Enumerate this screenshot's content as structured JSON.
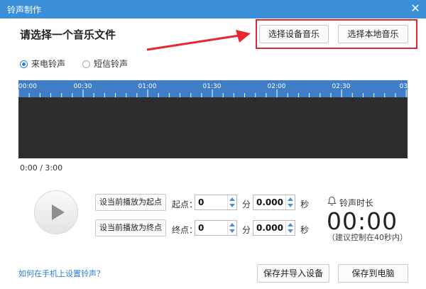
{
  "window": {
    "title": "铃声制作",
    "close_glyph": "✕"
  },
  "header": {
    "heading": "请选择一个音乐文件",
    "device_button": "选择设备音乐",
    "local_button": "选择本地音乐"
  },
  "ringtone_type": {
    "options": [
      {
        "label": "来电铃声",
        "checked": true
      },
      {
        "label": "短信铃声",
        "checked": false
      }
    ]
  },
  "timeline": {
    "tick_labels": [
      "00:00",
      "00:30",
      "01:00",
      "01:30",
      "02:00",
      "02:30",
      "03"
    ],
    "ruler_color": "#3f7ec7",
    "wave_color": "#2d2d2d"
  },
  "playback": {
    "current_time": "0:00 / 3:00"
  },
  "start": {
    "set_button": "设当前播放为起点",
    "label": "起点：",
    "minutes": "0",
    "min_unit": "分",
    "seconds": "0.000",
    "sec_unit": "秒"
  },
  "end": {
    "set_button": "设当前播放为终点",
    "label": "终点：",
    "minutes": "0",
    "min_unit": "分",
    "seconds": "0.000",
    "sec_unit": "秒"
  },
  "duration": {
    "label": "铃声时长",
    "value": "00:00",
    "hint": "（建议控制在40秒内）"
  },
  "footer": {
    "help_link": "如何在手机上设置铃声？",
    "save_import_button": "保存并导入设备",
    "save_pc_button": "保存到电脑"
  },
  "colors": {
    "title_bar": "#3b8fd8",
    "highlight": "#e8262d",
    "accent": "#2f7fd6"
  }
}
